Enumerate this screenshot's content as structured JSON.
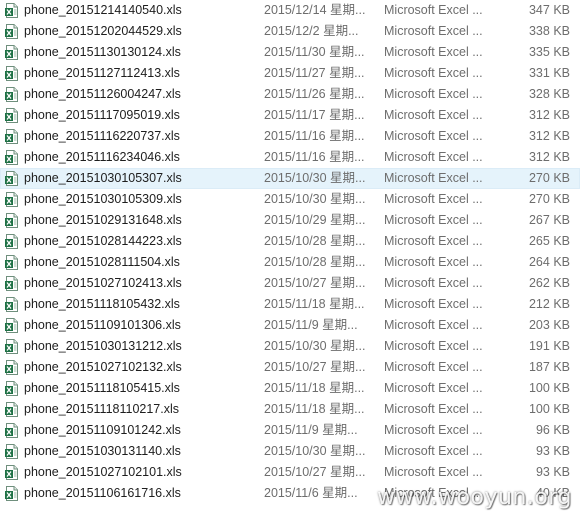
{
  "files": [
    {
      "name": "phone_20151214140540.xls",
      "date": "2015/12/14 星期...",
      "type": "Microsoft Excel ...",
      "size": "347 KB"
    },
    {
      "name": "phone_20151202044529.xls",
      "date": "2015/12/2 星期...",
      "type": "Microsoft Excel ...",
      "size": "338 KB"
    },
    {
      "name": "phone_20151130130124.xls",
      "date": "2015/11/30 星期...",
      "type": "Microsoft Excel ...",
      "size": "335 KB"
    },
    {
      "name": "phone_20151127112413.xls",
      "date": "2015/11/27 星期...",
      "type": "Microsoft Excel ...",
      "size": "331 KB"
    },
    {
      "name": "phone_20151126004247.xls",
      "date": "2015/11/26 星期...",
      "type": "Microsoft Excel ...",
      "size": "328 KB"
    },
    {
      "name": "phone_20151117095019.xls",
      "date": "2015/11/17 星期...",
      "type": "Microsoft Excel ...",
      "size": "312 KB"
    },
    {
      "name": "phone_20151116220737.xls",
      "date": "2015/11/16 星期...",
      "type": "Microsoft Excel ...",
      "size": "312 KB"
    },
    {
      "name": "phone_20151116234046.xls",
      "date": "2015/11/16 星期...",
      "type": "Microsoft Excel ...",
      "size": "312 KB"
    },
    {
      "name": "phone_20151030105307.xls",
      "date": "2015/10/30 星期...",
      "type": "Microsoft Excel ...",
      "size": "270 KB",
      "selected": true
    },
    {
      "name": "phone_20151030105309.xls",
      "date": "2015/10/30 星期...",
      "type": "Microsoft Excel ...",
      "size": "270 KB"
    },
    {
      "name": "phone_20151029131648.xls",
      "date": "2015/10/29 星期...",
      "type": "Microsoft Excel ...",
      "size": "267 KB"
    },
    {
      "name": "phone_20151028144223.xls",
      "date": "2015/10/28 星期...",
      "type": "Microsoft Excel ...",
      "size": "265 KB"
    },
    {
      "name": "phone_20151028111504.xls",
      "date": "2015/10/28 星期...",
      "type": "Microsoft Excel ...",
      "size": "264 KB"
    },
    {
      "name": "phone_20151027102413.xls",
      "date": "2015/10/27 星期...",
      "type": "Microsoft Excel ...",
      "size": "262 KB"
    },
    {
      "name": "phone_20151118105432.xls",
      "date": "2015/11/18 星期...",
      "type": "Microsoft Excel ...",
      "size": "212 KB"
    },
    {
      "name": "phone_20151109101306.xls",
      "date": "2015/11/9 星期...",
      "type": "Microsoft Excel ...",
      "size": "203 KB"
    },
    {
      "name": "phone_20151030131212.xls",
      "date": "2015/10/30 星期...",
      "type": "Microsoft Excel ...",
      "size": "191 KB"
    },
    {
      "name": "phone_20151027102132.xls",
      "date": "2015/10/27 星期...",
      "type": "Microsoft Excel ...",
      "size": "187 KB"
    },
    {
      "name": "phone_20151118105415.xls",
      "date": "2015/11/18 星期...",
      "type": "Microsoft Excel ...",
      "size": "100 KB"
    },
    {
      "name": "phone_20151118110217.xls",
      "date": "2015/11/18 星期...",
      "type": "Microsoft Excel ...",
      "size": "100 KB"
    },
    {
      "name": "phone_20151109101242.xls",
      "date": "2015/11/9 星期...",
      "type": "Microsoft Excel ...",
      "size": "96 KB"
    },
    {
      "name": "phone_20151030131140.xls",
      "date": "2015/10/30 星期...",
      "type": "Microsoft Excel ...",
      "size": "93 KB"
    },
    {
      "name": "phone_20151027102101.xls",
      "date": "2015/10/27 星期...",
      "type": "Microsoft Excel ...",
      "size": "93 KB"
    },
    {
      "name": "phone_20151106161716.xls",
      "date": "2015/11/6 星期...",
      "type": "Microsoft Excel ...",
      "size": "40 KB"
    }
  ],
  "file_icon": "excel-file-icon",
  "watermark": "www.wooyun.org",
  "colors": {
    "selection_bg": "#e5f3fb",
    "excel_green": "#1e7145",
    "secondary_text": "#6d6d6d"
  }
}
